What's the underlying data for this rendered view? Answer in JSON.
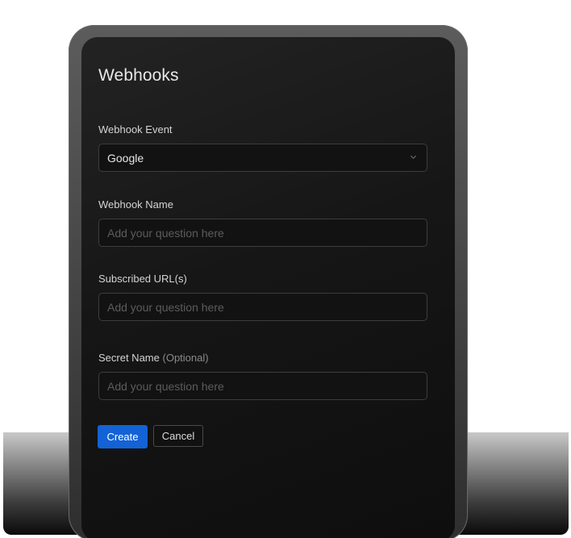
{
  "form": {
    "title": "Webhooks",
    "event": {
      "label": "Webhook Event",
      "selected": "Google",
      "icon": "chevron-down-icon"
    },
    "name": {
      "label": "Webhook Name",
      "value": "",
      "placeholder": "Add your question here"
    },
    "url": {
      "label": "Subscribed URL(s)",
      "value": "",
      "placeholder": "Add your question here"
    },
    "secret": {
      "label": "Secret Name",
      "optional_note": "(Optional)",
      "value": "",
      "placeholder": "Add your question here"
    },
    "buttons": {
      "create_label": "Create",
      "cancel_label": "Cancel"
    }
  },
  "colors": {
    "accent": "#1363d6",
    "panel_background": "#161616",
    "field_border": "#3d3d3d"
  }
}
